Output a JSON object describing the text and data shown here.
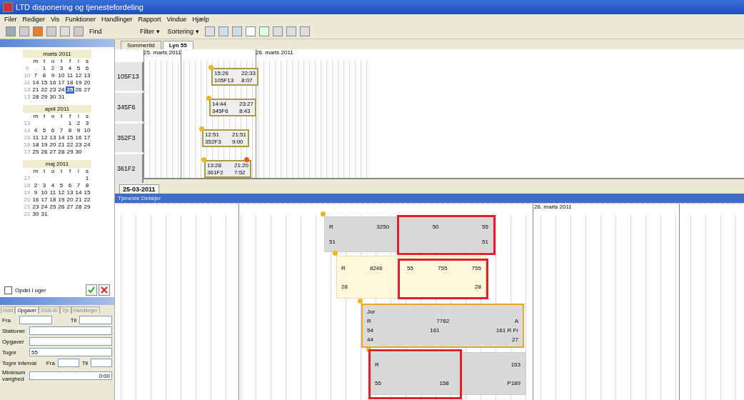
{
  "window": {
    "title": "LTD disponering og tjenestefordeling"
  },
  "menu": [
    "Filer",
    "Rediger",
    "Vis",
    "Funktioner",
    "Handlinger",
    "Rapport",
    "Vindue",
    "Hjælp"
  ],
  "toolbar": {
    "find": "Find",
    "filter": "Filter ▾",
    "sort": "Sortering ▾"
  },
  "calendars": [
    {
      "title": "marts 2011",
      "day_names": [
        "m",
        "t",
        "o",
        "t",
        "f",
        "l",
        "s"
      ],
      "weeks": [
        {
          "number": "9",
          "days": [
            {
              "d": "1",
              "selected": false
            },
            {
              "d": "2",
              "selected": false
            },
            {
              "d": "3",
              "selected": false
            },
            {
              "d": "4",
              "selected": false
            },
            {
              "d": "5",
              "selected": false
            },
            {
              "d": "6",
              "selected": false
            }
          ]
        },
        {
          "number": "10",
          "days": [
            {
              "d": "7",
              "selected": false
            },
            {
              "d": "8",
              "selected": false
            },
            {
              "d": "9",
              "selected": false
            },
            {
              "d": "10",
              "selected": false
            },
            {
              "d": "11",
              "selected": false
            },
            {
              "d": "12",
              "selected": false
            },
            {
              "d": "13",
              "selected": false
            }
          ]
        },
        {
          "number": "11",
          "days": [
            {
              "d": "14",
              "selected": false
            },
            {
              "d": "15",
              "selected": false
            },
            {
              "d": "16",
              "selected": false
            },
            {
              "d": "17",
              "selected": false
            },
            {
              "d": "18",
              "selected": false
            },
            {
              "d": "19",
              "selected": false
            },
            {
              "d": "20",
              "selected": false
            }
          ]
        },
        {
          "number": "12",
          "days": [
            {
              "d": "21",
              "selected": false
            },
            {
              "d": "22",
              "selected": false
            },
            {
              "d": "23",
              "selected": false
            },
            {
              "d": "24",
              "selected": false
            },
            {
              "d": "25",
              "selected": true
            },
            {
              "d": "26",
              "selected": false
            },
            {
              "d": "27",
              "selected": false
            }
          ]
        },
        {
          "number": "13",
          "days": [
            {
              "d": "28",
              "selected": false
            },
            {
              "d": "29",
              "selected": false
            },
            {
              "d": "30",
              "selected": false
            },
            {
              "d": "31",
              "selected": false
            }
          ]
        }
      ]
    },
    {
      "title": "april 2011",
      "day_names": [
        "m",
        "t",
        "o",
        "t",
        "f",
        "l",
        "s"
      ],
      "weeks": [
        {
          "number": "13",
          "days": [
            {
              "d": "1",
              "selected": false
            },
            {
              "d": "2",
              "selected": false
            },
            {
              "d": "3",
              "selected": false
            }
          ]
        },
        {
          "number": "14",
          "days": [
            {
              "d": "4",
              "selected": false
            },
            {
              "d": "5",
              "selected": false
            },
            {
              "d": "6",
              "selected": false
            },
            {
              "d": "7",
              "selected": false
            },
            {
              "d": "8",
              "selected": false
            },
            {
              "d": "9",
              "selected": false
            },
            {
              "d": "10",
              "selected": false
            }
          ]
        },
        {
          "number": "15",
          "days": [
            {
              "d": "11",
              "selected": false
            },
            {
              "d": "12",
              "selected": false
            },
            {
              "d": "13",
              "selected": false
            },
            {
              "d": "14",
              "selected": false
            },
            {
              "d": "15",
              "selected": false
            },
            {
              "d": "16",
              "selected": false
            },
            {
              "d": "17",
              "selected": false
            }
          ]
        },
        {
          "number": "16",
          "days": [
            {
              "d": "18",
              "selected": false
            },
            {
              "d": "19",
              "selected": false
            },
            {
              "d": "20",
              "selected": false
            },
            {
              "d": "21",
              "selected": false
            },
            {
              "d": "22",
              "selected": false
            },
            {
              "d": "23",
              "selected": false
            },
            {
              "d": "24",
              "selected": false
            }
          ]
        },
        {
          "number": "17",
          "days": [
            {
              "d": "25",
              "selected": false
            },
            {
              "d": "26",
              "selected": false
            },
            {
              "d": "27",
              "selected": false
            },
            {
              "d": "28",
              "selected": false
            },
            {
              "d": "29",
              "selected": false
            },
            {
              "d": "30",
              "selected": false
            }
          ]
        }
      ]
    },
    {
      "title": "maj 2011",
      "day_names": [
        "m",
        "t",
        "o",
        "t",
        "f",
        "l",
        "s"
      ],
      "weeks": [
        {
          "number": "17",
          "days": [
            {
              "d": "1",
              "selected": false
            }
          ]
        },
        {
          "number": "18",
          "days": [
            {
              "d": "2",
              "selected": false
            },
            {
              "d": "3",
              "selected": false
            },
            {
              "d": "4",
              "selected": false
            },
            {
              "d": "5",
              "selected": false
            },
            {
              "d": "6",
              "selected": false
            },
            {
              "d": "7",
              "selected": false
            },
            {
              "d": "8",
              "selected": false
            }
          ]
        },
        {
          "number": "19",
          "days": [
            {
              "d": "9",
              "selected": false
            },
            {
              "d": "10",
              "selected": false
            },
            {
              "d": "11",
              "selected": false
            },
            {
              "d": "12",
              "selected": false
            },
            {
              "d": "13",
              "selected": false
            },
            {
              "d": "14",
              "selected": false
            },
            {
              "d": "15",
              "selected": false
            }
          ]
        },
        {
          "number": "20",
          "days": [
            {
              "d": "16",
              "selected": false
            },
            {
              "d": "17",
              "selected": false
            },
            {
              "d": "18",
              "selected": false
            },
            {
              "d": "19",
              "selected": false
            },
            {
              "d": "20",
              "selected": false
            },
            {
              "d": "21",
              "selected": false
            },
            {
              "d": "22",
              "selected": false
            }
          ]
        },
        {
          "number": "21",
          "days": [
            {
              "d": "23",
              "selected": false
            },
            {
              "d": "24",
              "selected": false
            },
            {
              "d": "25",
              "selected": false
            },
            {
              "d": "26",
              "selected": false
            },
            {
              "d": "27",
              "selected": false
            },
            {
              "d": "28",
              "selected": false
            },
            {
              "d": "29",
              "selected": false
            }
          ]
        },
        {
          "number": "22",
          "days": [
            {
              "d": "30",
              "selected": false
            },
            {
              "d": "31",
              "selected": false
            }
          ]
        }
      ]
    }
  ],
  "split_weeks": {
    "label": "Opdel i uger",
    "checked": false
  },
  "filter_panel": {
    "tabs": [
      {
        "label": "Hold",
        "selected": false
      },
      {
        "label": "Opgaver",
        "selected": true
      },
      {
        "label": "DSB-ID",
        "selected": false
      },
      {
        "label": "Tjn",
        "selected": false
      },
      {
        "label": "Handlinger",
        "selected": false
      }
    ],
    "from_label": "Fra",
    "to_label": "Til",
    "stations_label": "Stationer",
    "tasks_label": "Opgaver",
    "train_label": "Tognr",
    "train_value": "55",
    "interval_label": "Tognr interval",
    "interval_from": "Fra",
    "interval_to": "Til",
    "min_label": "Minimum varighed",
    "min_value": "0:00"
  },
  "plan_tabs": [
    {
      "label": "Sommertid",
      "selected": false
    },
    {
      "label": "Lyn 55",
      "selected": true
    }
  ],
  "gantt": {
    "dates": [
      "25. marts 2011",
      "26. marts 2011"
    ],
    "rows": [
      {
        "label": "105F13",
        "start": "15:26",
        "end": "22:33",
        "code": "105F13",
        "duration": "8:07",
        "alert": false
      },
      {
        "label": "345F6",
        "start": "14:44",
        "end": "23:27",
        "code": "345F6",
        "duration": "8:43",
        "alert": false
      },
      {
        "label": "352F3",
        "start": "12:51",
        "end": "21:51",
        "code": "352F3",
        "duration": "9:00",
        "alert": false
      },
      {
        "label": "361F2",
        "start": "13:28",
        "end": "21:20",
        "code": "361F2",
        "duration": "7:52",
        "alert": true
      }
    ]
  },
  "date_tab": "25-03-2011",
  "details": {
    "title": "Tjeneste Detaljer",
    "date": "26. marts 2011",
    "duties": [
      {
        "kind": "plain",
        "lines": [
          [
            "R",
            "3250",
            "50",
            "55"
          ],
          [
            "51",
            "51"
          ]
        ]
      },
      {
        "kind": "highlighted",
        "lines": [
          [
            "R",
            "8246",
            "55",
            "755",
            "755"
          ],
          [
            "28",
            "28"
          ]
        ]
      },
      {
        "kind": "framed",
        "lines": [
          [
            "Jor"
          ],
          [
            "R",
            "7762",
            "A"
          ],
          [
            "54",
            "161",
            "161 R Fr"
          ],
          [
            "44",
            "27"
          ]
        ]
      },
      {
        "kind": "plain",
        "lines": [
          [
            "R",
            "153"
          ],
          [
            "55",
            "158",
            "P189"
          ]
        ]
      }
    ]
  }
}
